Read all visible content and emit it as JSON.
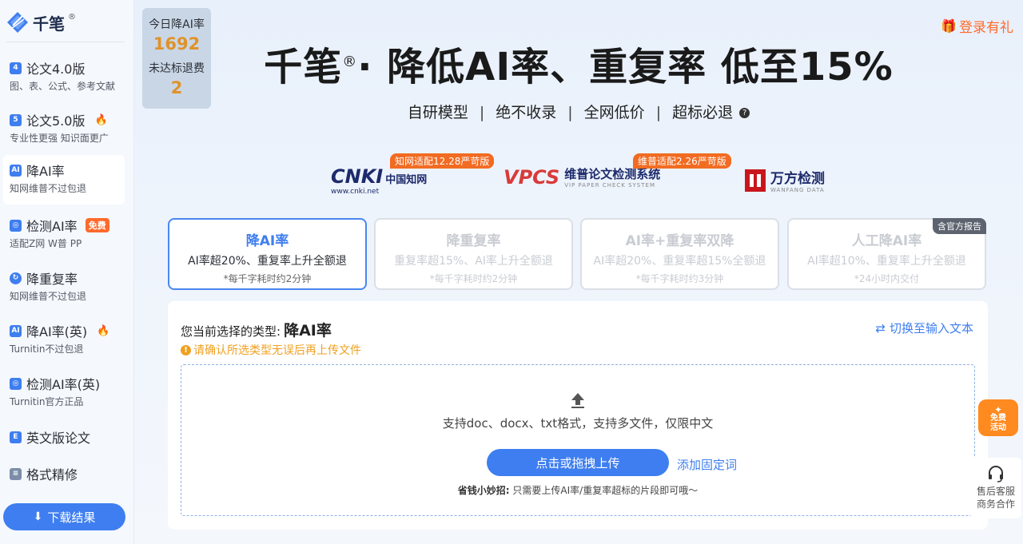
{
  "brand": {
    "name": "千笔",
    "reg": "®"
  },
  "sidebar": {
    "items": [
      {
        "icon": "4",
        "title": "论文4.0版",
        "sub": "图、表、公式、参考文献",
        "fire": false,
        "badge": ""
      },
      {
        "icon": "5",
        "title": "论文5.0版",
        "sub": "专业性更强 知识面更广",
        "fire": true,
        "badge": ""
      },
      {
        "icon": "AI",
        "title": "降AI率",
        "sub": "知网维普不过包退",
        "fire": false,
        "badge": ""
      },
      {
        "icon": "◎",
        "title": "检测AI率",
        "sub": "适配Z网 W普 PP",
        "fire": false,
        "badge": "免费"
      },
      {
        "icon": "↻",
        "title": "降重复率",
        "sub": "知网维普不过包退",
        "fire": false,
        "badge": ""
      },
      {
        "icon": "AI",
        "title": "降AI率(英)",
        "sub": "Turnitin不过包退",
        "fire": true,
        "badge": ""
      },
      {
        "icon": "◎",
        "title": "检测AI率(英)",
        "sub": "Turnitin官方正品",
        "fire": false,
        "badge": ""
      },
      {
        "icon": "E",
        "title": "英文版论文",
        "sub": "",
        "fire": false,
        "badge": ""
      },
      {
        "icon": "≡",
        "title": "格式精修",
        "sub": "",
        "fire": false,
        "badge": ""
      }
    ],
    "download_label": "下载结果"
  },
  "stats": {
    "today_label": "今日降AI率",
    "today_value": "1692",
    "refund_label": "未达标退费",
    "refund_value": "2"
  },
  "signup_label": "登录有礼",
  "hero": {
    "title_brand": "千笔",
    "title_reg": "®",
    "title_rest": "· 降低AI率、重复率 低至15%",
    "features": [
      "自研模型",
      "绝不收录",
      "全网低价",
      "超标必退"
    ]
  },
  "partners": {
    "cnki": {
      "badge": "知网适配12.28严苛版",
      "logo": "CNKI",
      "cn": "中国知网",
      "url": "www.cnki.net"
    },
    "vpcs": {
      "badge": "维普适配2.26严苛版",
      "logo": "VPCS",
      "name": "维普论文检测系统",
      "en": "VIP PAPER CHECK SYSTEM"
    },
    "wanfang": {
      "name": "万方检测",
      "en": "WANFANG DATA"
    }
  },
  "modes": [
    {
      "title": "降AI率",
      "desc": "AI率超20%、重复率上升全额退",
      "note": "*每千字耗时约2分钟",
      "tag": ""
    },
    {
      "title": "降重复率",
      "desc": "重复率超15%、AI率上升全额退",
      "note": "*每千字耗时约2分钟",
      "tag": ""
    },
    {
      "title": "AI率+重复率双降",
      "desc": "AI率超20%、重复率超15%全额退",
      "note": "*每千字耗时约3分钟",
      "tag": ""
    },
    {
      "title": "人工降AI率",
      "desc": "AI率超10%、重复率上升全额退",
      "note": "*24小时内交付",
      "tag": "含官方报告"
    }
  ],
  "panel": {
    "type_label": "您当前选择的类型:",
    "type_value": "降AI率",
    "switch_label": "切换至输入文本",
    "warning": "请确认所选类型无误后再上传文件",
    "formats": "支持doc、docx、txt格式，支持多文件，仅限中文",
    "upload_label": "点击或拖拽上传",
    "add_link": "添加固定词",
    "tip_bold": "省钱小妙招:",
    "tip_text": " 只需要上传AI率/重复率超标的片段即可哦～"
  },
  "floating": {
    "promo_line1": "免费",
    "promo_line2": "活动",
    "service_line1": "售后客服",
    "service_line2": "商务合作"
  },
  "colors": {
    "accent": "#3e7ef0",
    "orange": "#ff6a2b",
    "gold": "#e0922a"
  }
}
